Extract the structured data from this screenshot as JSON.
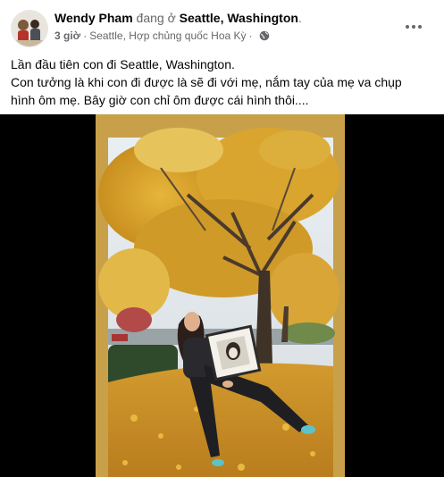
{
  "post": {
    "author_name": "Wendy Pham",
    "author_verb": "đang ở",
    "location": "Seattle, Washington",
    "location_suffix": ".",
    "time": "3 giờ",
    "separator": "·",
    "place_detail": "Seattle, Hợp chủng quốc Hoa Kỳ",
    "privacy_icon": "globe-icon",
    "more_icon": "more-options-icon",
    "caption_lines": [
      "Lần đầu tiên con đi Seattle, Washington.",
      "Con tưởng là khi con đi được là sẽ đi với mẹ, nắm tay của mẹ va chụp",
      "hình ôm mẹ. Bây giờ con chỉ ôm được cái hình thôi...."
    ]
  },
  "media": {
    "type": "video",
    "frame_color": "#c9a04a",
    "background": "#000000"
  }
}
